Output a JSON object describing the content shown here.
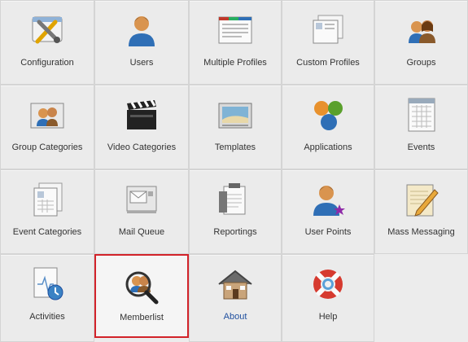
{
  "items": [
    {
      "label": "Configuration",
      "icon": "configuration-tools-icon"
    },
    {
      "label": "Users",
      "icon": "user-icon"
    },
    {
      "label": "Multiple Profiles",
      "icon": "multiple-profiles-icon"
    },
    {
      "label": "Custom Profiles",
      "icon": "custom-profiles-icon"
    },
    {
      "label": "Groups",
      "icon": "groups-icon"
    },
    {
      "label": "Group Categories",
      "icon": "group-categories-icon"
    },
    {
      "label": "Video Categories",
      "icon": "clapperboard-icon"
    },
    {
      "label": "Templates",
      "icon": "templates-icon"
    },
    {
      "label": "Applications",
      "icon": "applications-icon"
    },
    {
      "label": "Events",
      "icon": "calendar-icon"
    },
    {
      "label": "Event Categories",
      "icon": "event-categories-icon"
    },
    {
      "label": "Mail Queue",
      "icon": "mail-queue-icon"
    },
    {
      "label": "Reportings",
      "icon": "reportings-icon"
    },
    {
      "label": "User Points",
      "icon": "user-points-icon"
    },
    {
      "label": "Mass Messaging",
      "icon": "mass-messaging-icon"
    },
    {
      "label": "Activities",
      "icon": "activities-icon"
    },
    {
      "label": "Memberlist",
      "icon": "memberlist-icon"
    },
    {
      "label": "About",
      "icon": "house-icon"
    },
    {
      "label": "Help",
      "icon": "lifebuoy-icon"
    }
  ],
  "highlighted": "Memberlist",
  "colors": {
    "highlight_border": "#d2232a",
    "link": "#1f4f9e"
  }
}
